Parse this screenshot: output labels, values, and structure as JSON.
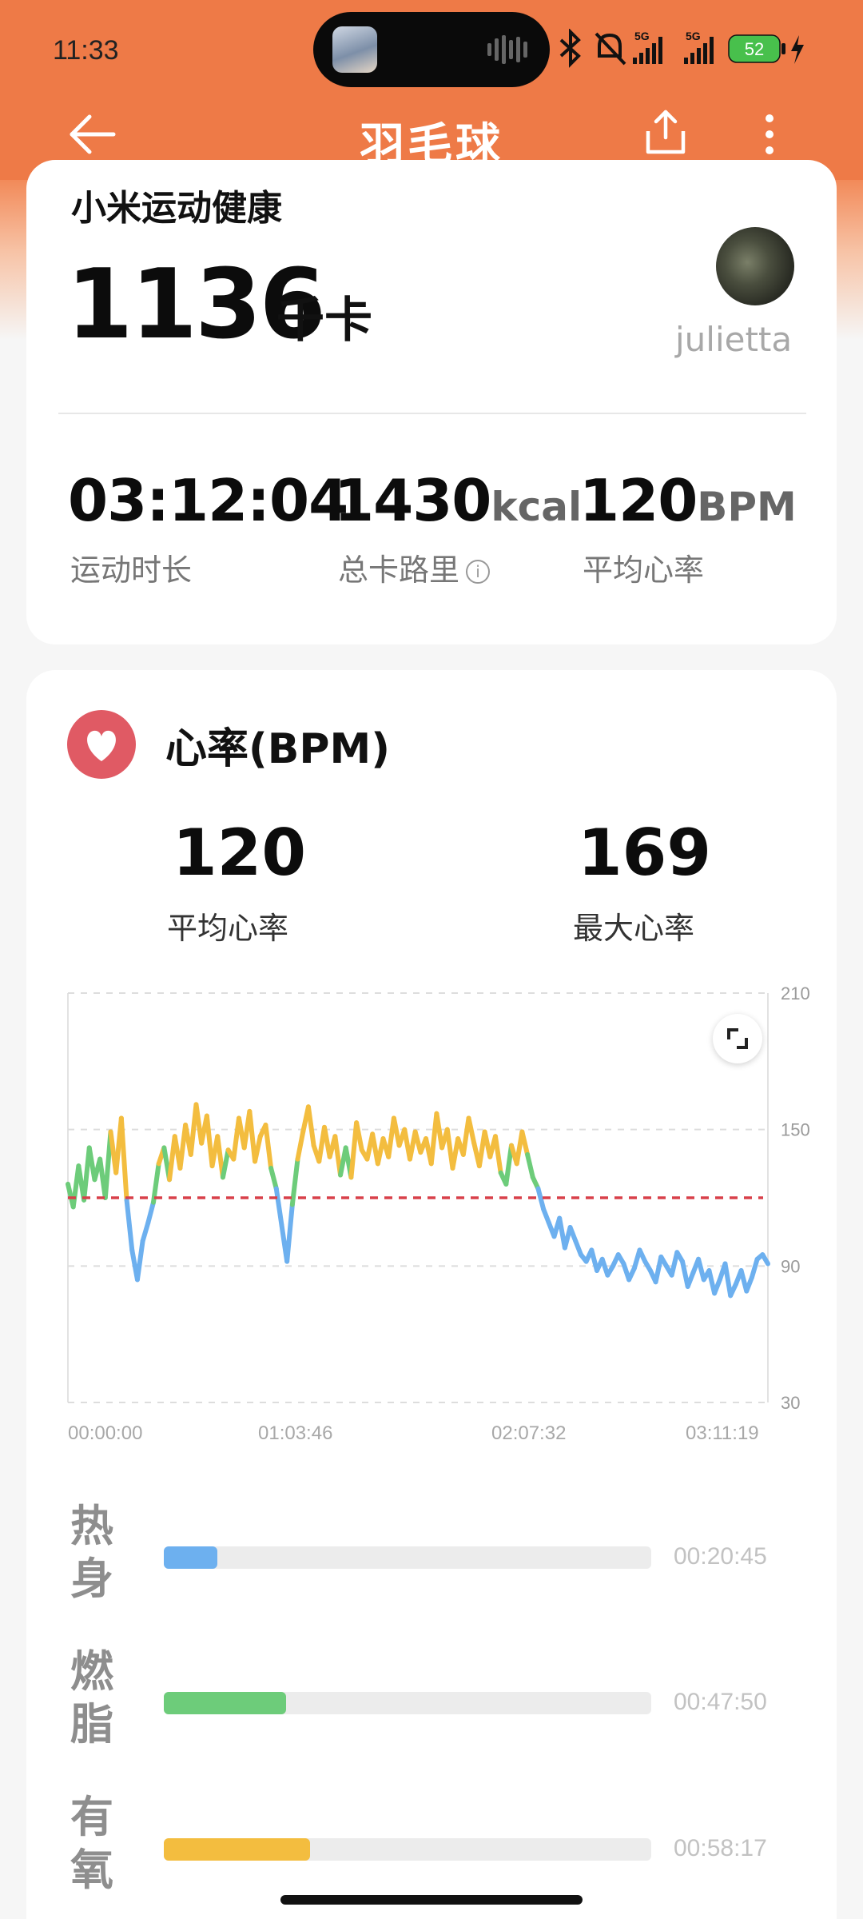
{
  "status_bar": {
    "time": "11:33",
    "network_1": "5G",
    "network_2": "5G",
    "battery": "52"
  },
  "nav": {
    "title": "羽毛球",
    "back_icon": "arrow-left-icon",
    "share_icon": "share-icon",
    "more_icon": "more-vertical-icon"
  },
  "summary": {
    "brand": "小米运动健康",
    "calories_value": "1136",
    "calories_unit": "千卡",
    "username": "julietta",
    "stats": [
      {
        "value": "03:12:04",
        "unit": "",
        "label": "运动时长"
      },
      {
        "value": "1430",
        "unit": "kcal",
        "label": "总卡路里"
      },
      {
        "value": "120",
        "unit": "BPM",
        "label": "平均心率"
      }
    ]
  },
  "heart_rate": {
    "title": "心率(BPM)",
    "avg_value": "120",
    "avg_label": "平均心率",
    "max_value": "169",
    "max_label": "最大心率"
  },
  "chart_data": {
    "type": "line",
    "x_ticks": [
      "00:00:00",
      "01:03:46",
      "02:07:32",
      "03:11:19"
    ],
    "y_ticks": [
      210,
      150,
      90,
      30
    ],
    "ylim": [
      30,
      210
    ],
    "average_line": 120,
    "zone_thresholds": {
      "warmup_max": 120,
      "fatburn_max": 137
    },
    "colors": {
      "warmup": "#6db0ef",
      "fatburn": "#6dcc7a",
      "aerobic": "#f3bd3f",
      "anaerobic": "#ed8b3e",
      "avg_line": "#d8404a"
    },
    "x_seconds_total": 11479,
    "values": [
      126,
      116,
      134,
      119,
      142,
      128,
      137,
      120,
      149,
      131,
      155,
      119,
      97,
      84,
      101,
      109,
      118,
      135,
      142,
      128,
      147,
      133,
      152,
      139,
      161,
      144,
      156,
      134,
      147,
      129,
      141,
      137,
      155,
      142,
      158,
      136,
      147,
      152,
      133,
      124,
      108,
      92,
      117,
      137,
      149,
      160,
      143,
      136,
      151,
      138,
      147,
      130,
      142,
      129,
      153,
      141,
      137,
      148,
      135,
      146,
      138,
      155,
      143,
      150,
      137,
      149,
      140,
      146,
      135,
      157,
      142,
      150,
      133,
      146,
      139,
      155,
      144,
      134,
      149,
      138,
      147,
      131,
      126,
      143,
      135,
      149,
      139,
      129,
      124,
      115,
      109,
      103,
      111,
      98,
      107,
      101,
      95,
      92,
      97,
      88,
      93,
      86,
      90,
      95,
      91,
      84,
      89,
      97,
      92,
      88,
      83,
      94,
      90,
      86,
      96,
      92,
      81,
      87,
      93,
      84,
      88,
      78,
      84,
      91,
      77,
      82,
      88,
      79,
      85,
      93,
      95,
      91
    ]
  },
  "zones": [
    {
      "label": "热身",
      "time": "00:20:45",
      "fraction": 0.11,
      "color": "#6db0ef"
    },
    {
      "label": "燃脂",
      "time": "00:47:50",
      "fraction": 0.25,
      "color": "#6dcc7a"
    },
    {
      "label": "有氧",
      "time": "00:58:17",
      "fraction": 0.3,
      "color": "#f3bd3f"
    }
  ]
}
